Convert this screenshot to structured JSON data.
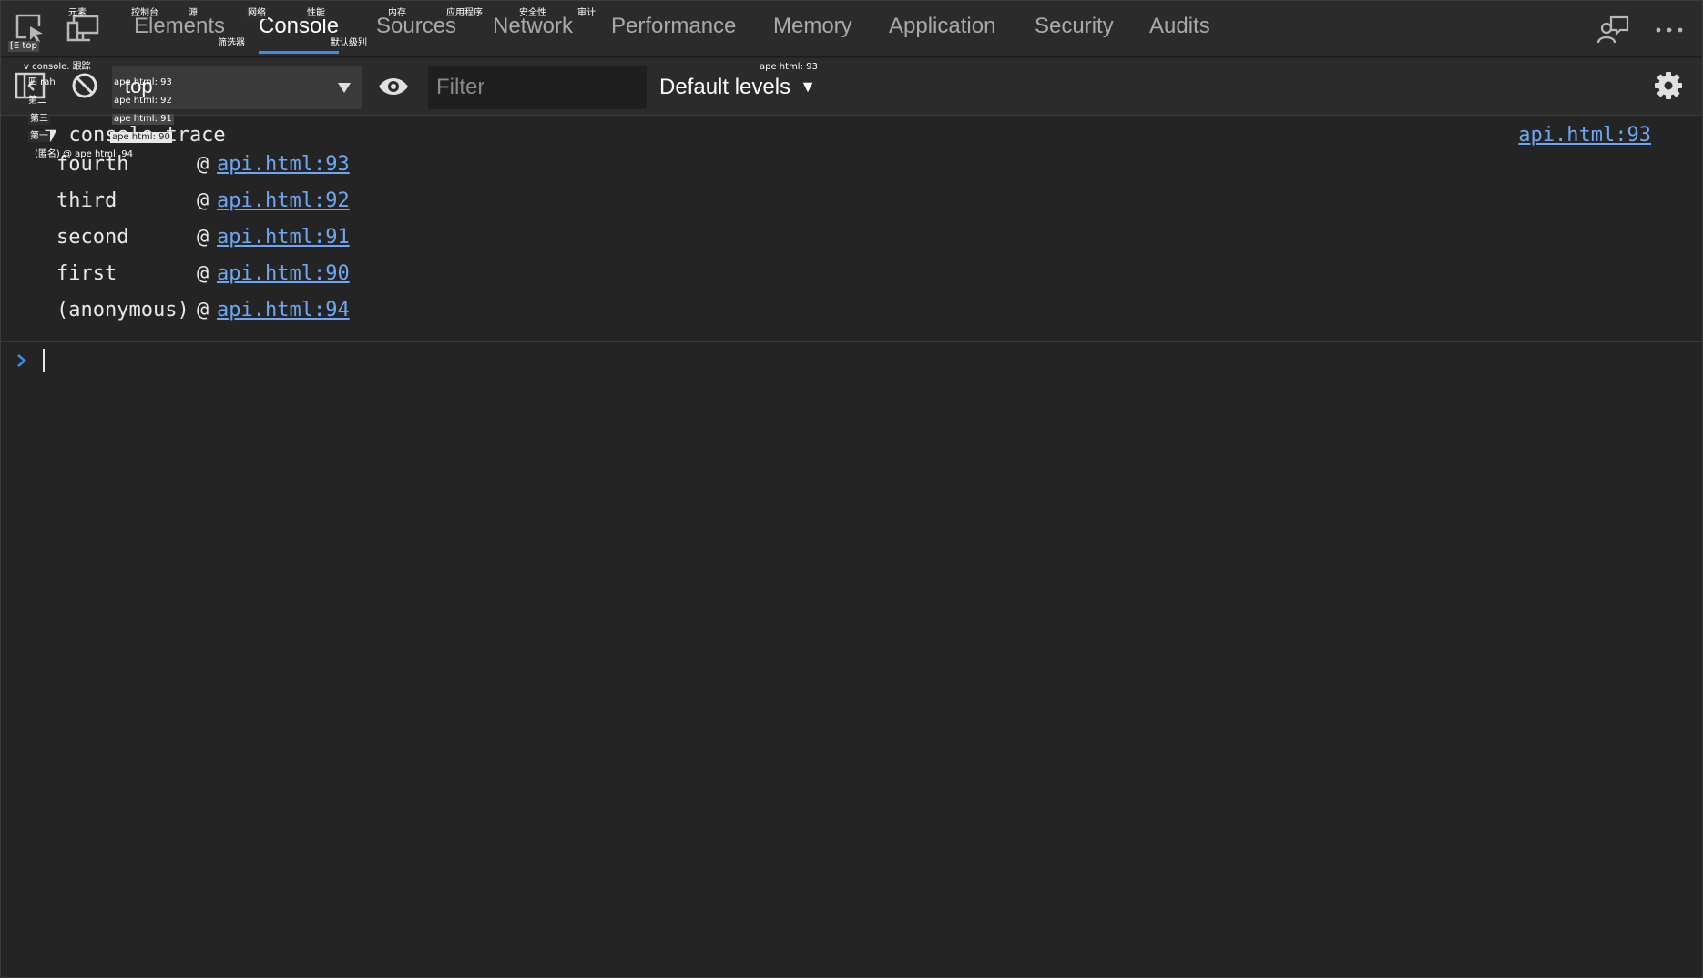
{
  "tabs": {
    "items": [
      {
        "label": "Elements"
      },
      {
        "label": "Console"
      },
      {
        "label": "Sources"
      },
      {
        "label": "Network"
      },
      {
        "label": "Performance"
      },
      {
        "label": "Memory"
      },
      {
        "label": "Application"
      },
      {
        "label": "Security"
      },
      {
        "label": "Audits"
      }
    ],
    "active": "Console"
  },
  "toolbar": {
    "context_value": "top",
    "filter_placeholder": "Filter",
    "levels_label": "Default levels",
    "levels_arrow": "▼"
  },
  "console": {
    "trace_head": "▼ console.trace",
    "trace_source": "api.html:93",
    "frames": [
      {
        "fn": "fourth",
        "at": "@",
        "loc": "api.html:93"
      },
      {
        "fn": "third",
        "at": "@",
        "loc": "api.html:92"
      },
      {
        "fn": "second",
        "at": "@",
        "loc": "api.html:91"
      },
      {
        "fn": "first",
        "at": "@",
        "loc": "api.html:90"
      },
      {
        "fn": "(anonymous)",
        "at": "@",
        "loc": "api.html:94"
      }
    ]
  },
  "overlay_labels": {
    "elements": "元素",
    "console": "控制台",
    "sources": "源",
    "network": "网络",
    "performance": "性能",
    "memory": "内存",
    "application": "应用程序",
    "security": "安全性",
    "audits": "审计",
    "filter": "筛选器",
    "default_levels": "默认级别",
    "top_ctx": "[E top",
    "console_trace": "v console. 跟踪",
    "fourth": "四 rah",
    "third": "第三",
    "second": "第二",
    "first": "第一",
    "anonymous": "(匿名) @ ape html: 94",
    "src93a": "ape html: 93",
    "src92": "ape html: 92",
    "src91": "ape html: 91",
    "src90": "ape html: 90",
    "src93b": "ape html: 93"
  },
  "colors": {
    "background": "#242424",
    "toolbar": "#2b2b2b",
    "accent": "#3a8ee6",
    "link": "#6ea6f2"
  }
}
